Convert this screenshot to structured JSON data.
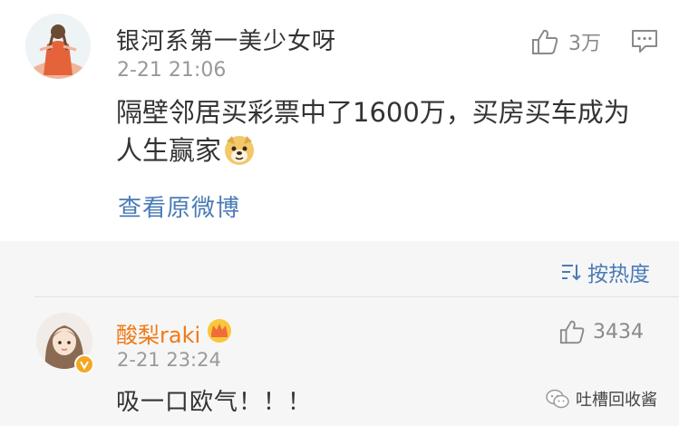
{
  "comment1": {
    "username": "银河系第一美少女呀",
    "time": "2-21 21:06",
    "content": "隔壁邻居买彩票中了1600万，买房买车成为人生赢家",
    "link": "查看原微博",
    "likes": "3万"
  },
  "sort": {
    "label": "按热度"
  },
  "comment2": {
    "username": "酸梨raki",
    "time": "2-21 23:24",
    "content": "吸一口欧气！！！",
    "likes": "3434"
  },
  "watermark": {
    "text": "吐槽回收酱"
  },
  "colors": {
    "link": "#4a7bb7",
    "vip_name": "#f07a17",
    "band": "#f6f6f6",
    "meta": "#999999"
  }
}
